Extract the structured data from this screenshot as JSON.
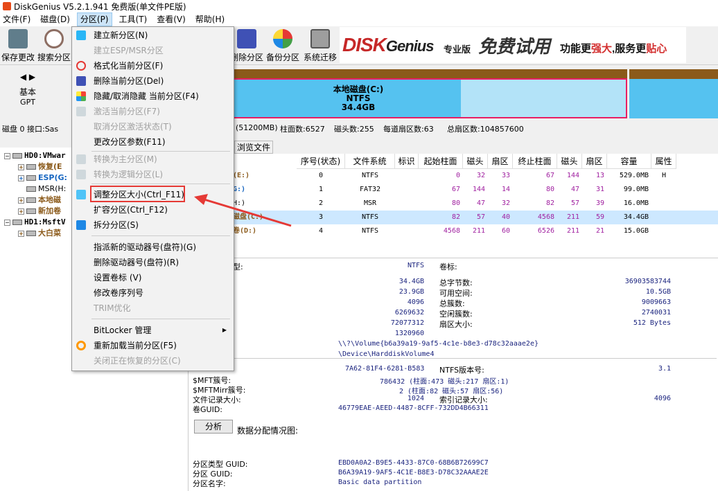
{
  "window": {
    "title": "DiskGenius V5.2.1.941 免费版(单文件PE版)"
  },
  "menubar": [
    "文件(F)",
    "磁盘(D)",
    "分区(P)",
    "工具(T)",
    "查看(V)",
    "帮助(H)"
  ],
  "toolbar": {
    "save": "保存更改",
    "search": "搜索分区",
    "delete": "删除分区",
    "backup": "备份分区",
    "migrate": "系统迁移"
  },
  "banner": {
    "logo_a": "DISK",
    "logo_b": "Genius",
    "edition": "专业版",
    "free_trial": "免费试用",
    "slogan_a": "功能更",
    "slogan_b": "强大",
    "slogan_c": ",服务更",
    "slogan_d": "贴心"
  },
  "disknav": {
    "type": "基本",
    "scheme": "GPT"
  },
  "partition_c": {
    "name": "本地磁盘(C:)",
    "fs": "NTFS",
    "size": "34.4GB"
  },
  "infoline": {
    "disk": "磁盘 0 接口:Sas",
    "capacity": "(51200MB)",
    "cylinders": "柱面数:6527",
    "heads": "磁头数:255",
    "sectors_per_track": "每道扇区数:63",
    "total_sectors": "总扇区数:104857600"
  },
  "tree": {
    "hd0": "HD0:VMwar",
    "items": [
      "恢复(E",
      "ESP(G:",
      "MSR(H:",
      "本地磁",
      "新加卷"
    ],
    "hd1": "HD1:MsftV",
    "hd1_items": [
      "大白菜"
    ]
  },
  "tabs": {
    "browse": "浏览文件"
  },
  "dropdown": {
    "items": [
      {
        "label": "建立新分区(N)",
        "disabled": false
      },
      {
        "label": "建立ESP/MSR分区",
        "disabled": true
      },
      {
        "label": "格式化当前分区(F)",
        "disabled": false
      },
      {
        "label": "删除当前分区(Del)",
        "disabled": false
      },
      {
        "label": "隐藏/取消隐藏 当前分区(F4)",
        "disabled": false
      },
      {
        "label": "激活当前分区(F7)",
        "disabled": true
      },
      {
        "label": "取消分区激活状态(T)",
        "disabled": true
      },
      {
        "label": "更改分区参数(F11)",
        "disabled": false
      },
      {
        "label": "转换为主分区(M)",
        "disabled": true
      },
      {
        "label": "转换为逻辑分区(L)",
        "disabled": true
      },
      {
        "label": "调整分区大小(Ctrl_F11)",
        "disabled": false
      },
      {
        "label": "扩容分区(Ctrl_F12)",
        "disabled": false
      },
      {
        "label": "拆分分区(S)",
        "disabled": false
      },
      {
        "label": "指派新的驱动器号(盘符)(G)",
        "disabled": false
      },
      {
        "label": "删除驱动器号(盘符)(R)",
        "disabled": false
      },
      {
        "label": "设置卷标 (V)",
        "disabled": false
      },
      {
        "label": "修改卷序列号",
        "disabled": false
      },
      {
        "label": "TRIM优化",
        "disabled": true
      },
      {
        "label": "BitLocker 管理",
        "disabled": false
      },
      {
        "label": "重新加载当前分区(F5)",
        "disabled": false
      },
      {
        "label": "关闭正在恢复的分区(C)",
        "disabled": true
      }
    ]
  },
  "table": {
    "headers": [
      "序号(状态)",
      "文件系统",
      "标识",
      "起始柱面",
      "磁头",
      "扇区",
      "终止柱面",
      "磁头",
      "扇区",
      "容量",
      "属性"
    ],
    "rows": [
      {
        "name": "(E:)",
        "idx": "0",
        "fs": "NTFS",
        "sc": "0",
        "sh": "32",
        "ss": "33",
        "ec": "67",
        "eh": "144",
        "es": "13",
        "cap": "529.0MB",
        "attr": "H"
      },
      {
        "name": "G:)",
        "idx": "1",
        "fs": "FAT32",
        "sc": "67",
        "sh": "144",
        "ss": "14",
        "ec": "80",
        "eh": "47",
        "es": "31",
        "cap": "99.0MB",
        "attr": ""
      },
      {
        "name": "H:)",
        "idx": "2",
        "fs": "MSR",
        "sc": "80",
        "sh": "47",
        "ss": "32",
        "ec": "82",
        "eh": "57",
        "es": "39",
        "cap": "16.0MB",
        "attr": ""
      },
      {
        "name": "磁盘(C:)",
        "idx": "3",
        "fs": "NTFS",
        "sc": "82",
        "sh": "57",
        "ss": "40",
        "ec": "4568",
        "eh": "211",
        "es": "59",
        "cap": "34.4GB",
        "attr": ""
      },
      {
        "name": "卷(D:)",
        "idx": "4",
        "fs": "NTFS",
        "sc": "4568",
        "sh": "211",
        "ss": "60",
        "ec": "6526",
        "eh": "211",
        "es": "21",
        "cap": "15.0GB",
        "attr": ""
      }
    ]
  },
  "details": {
    "fs_type_label": "型:",
    "fs_type": "NTFS",
    "volume_label": "卷标:",
    "v1": "34.4GB",
    "l_total_bytes": "总字节数:",
    "total_bytes": "36903583744",
    "v2": "23.9GB",
    "l_free": "可用空间:",
    "free": "10.5GB",
    "v3": "4096",
    "l_total_clusters": "总簇数:",
    "total_clusters": "9009663",
    "v4": "6269632",
    "l_free_clusters": "空闲簇数:",
    "free_clusters": "2740031",
    "v5": "72077312",
    "l_sector_size": "扇区大小:",
    "sector_size": "512 Bytes",
    "v6": "1320960",
    "volume_path": "\\\\?\\Volume{b6a39a19-9af5-4c1e-b8e3-d78c32aaae2e}",
    "device_path": "\\Device\\HarddiskVolume4",
    "serial": "7A62-81F4-6281-B583",
    "l_ntfs_ver": "NTFS版本号:",
    "ntfs_ver": "3.1",
    "l_mft": "$MFT簇号:",
    "mft": "786432 (柱面:473 磁头:217 扇区:1)",
    "l_mftmirr": "$MFTMirr簇号:",
    "mftmirr": "2 (柱面:82 磁头:57 扇区:56)",
    "l_record": "文件记录大小:",
    "record": "1024",
    "l_index": "索引记录大小:",
    "index": "4096",
    "l_vguid": "卷GUID:",
    "vguid": "46779EAE-AEED-4487-8CFF-732DD4B66311",
    "analyze": "分析",
    "alloc_label": "数据分配情况图:",
    "l_ptype_guid": "分区类型 GUID:",
    "ptype_guid": "EBD0A0A2-B9E5-4433-87C0-68B6B72699C7",
    "l_part_guid": "分区 GUID:",
    "part_guid": "B6A39A19-9AF5-4C1E-B8E3-D78C32AAAE2E",
    "l_part_name": "分区名字:",
    "part_name": "Basic data partition"
  },
  "colors": {
    "accent": "#55c2f0",
    "highlight": "#e53935",
    "brown": "#8b5a1a"
  }
}
